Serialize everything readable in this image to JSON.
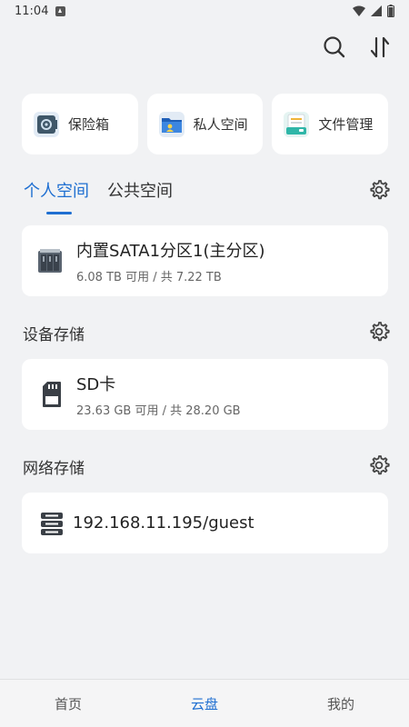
{
  "status_bar": {
    "time": "11:04"
  },
  "quick_access": [
    {
      "label": "保险箱",
      "icon": "safe-icon"
    },
    {
      "label": "私人空间",
      "icon": "private-folder-icon"
    },
    {
      "label": "文件管理",
      "icon": "file-manager-icon"
    }
  ],
  "tabs": [
    {
      "label": "个人空间",
      "active": true
    },
    {
      "label": "公共空间",
      "active": false
    }
  ],
  "personal_storage": {
    "name": "内置SATA1分区1(主分区)",
    "usage": "6.08 TB 可用 / 共 7.22 TB"
  },
  "device_storage": {
    "title": "设备存储",
    "name": "SD卡",
    "usage": "23.63 GB 可用 / 共 28.20 GB"
  },
  "network_storage": {
    "title": "网络存储",
    "address": "192.168.11.195/guest"
  },
  "bottom_nav": [
    {
      "label": "首页",
      "active": false
    },
    {
      "label": "云盘",
      "active": true
    },
    {
      "label": "我的",
      "active": false
    }
  ],
  "colors": {
    "accent": "#1f6fd1",
    "background": "#f1f2f4"
  }
}
